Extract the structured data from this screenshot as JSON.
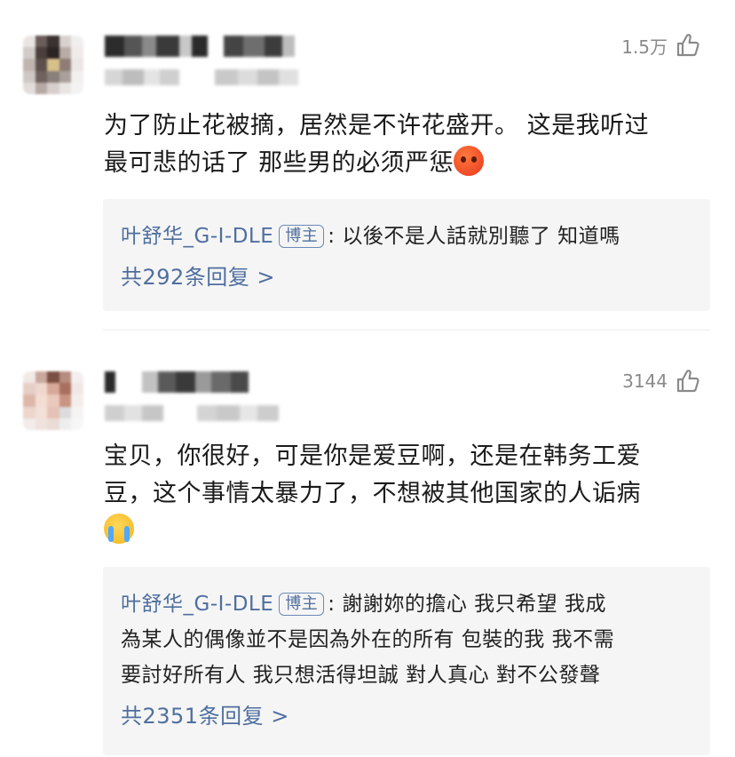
{
  "comments": [
    {
      "likes": "1.5万",
      "text_lines": [
        "为了防止花被摘，居然是不许花盛开。 这是我听过",
        "最可悲的话了  那些男的必须严惩"
      ],
      "emoji": "angry-face-emoji",
      "reply": {
        "author": "叶舒华_G-I-DLE",
        "badge": "博主",
        "sep": ":",
        "text_lines": [
          "以後不是人話就別聽了 知道嗎"
        ],
        "count": "共292条回复 >"
      }
    },
    {
      "likes": "3144",
      "text_lines": [
        "宝贝，你很好，可是你是爱豆啊，还是在韩务工爱",
        "豆，这个事情太暴力了，不想被其他国家的人诟病"
      ],
      "emoji": "crying-face-emoji",
      "reply": {
        "author": "叶舒华_G-I-DLE",
        "badge": "博主",
        "sep": ":",
        "text_lines": [
          "謝謝妳的擔心 我只希望 我成",
          "為某人的偶像並不是因為外在的所有 包裝的我 我不需",
          "要討好所有人 我只想活得坦誠 對人真心 對不公發聲"
        ],
        "count": "共2351条回复 >"
      }
    }
  ],
  "colors": {
    "link": "#4f6f9f",
    "reply_bg": "#f5f5f5",
    "muted": "#8a8a8a"
  }
}
